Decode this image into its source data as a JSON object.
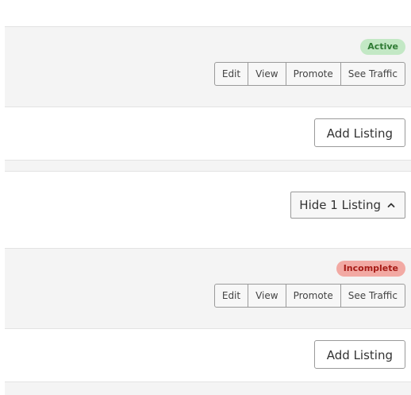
{
  "listings": [
    {
      "status": "Active",
      "actions": [
        "Edit",
        "View",
        "Promote",
        "See Traffic"
      ],
      "add_label": "Add Listing"
    },
    {
      "status": "Incomplete",
      "actions": [
        "Edit",
        "View",
        "Promote",
        "See Traffic"
      ],
      "add_label": "Add Listing"
    }
  ],
  "toggle": {
    "label": "Hide 1 Listing",
    "icon": "chevron-up-icon"
  },
  "colors": {
    "active_bg": "#c3e8c5",
    "active_text": "#2e7a33",
    "incomplete_bg": "#f2a9a3",
    "incomplete_text": "#a61b16"
  }
}
